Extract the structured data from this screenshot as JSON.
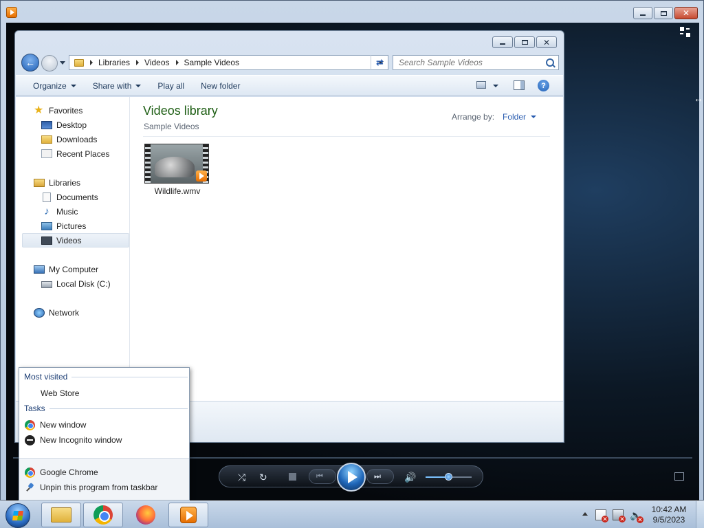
{
  "explorer": {
    "breadcrumb": [
      "Libraries",
      "Videos",
      "Sample Videos"
    ],
    "search_placeholder": "Search Sample Videos",
    "toolbar": {
      "organize": "Organize",
      "share_with": "Share with",
      "play_all": "Play all",
      "new_folder": "New folder"
    },
    "nav": {
      "favorites": "Favorites",
      "desktop": "Desktop",
      "downloads": "Downloads",
      "recent_places": "Recent Places",
      "libraries": "Libraries",
      "documents": "Documents",
      "music": "Music",
      "pictures": "Pictures",
      "videos": "Videos",
      "my_computer": "My Computer",
      "local_disk": "Local Disk (C:)",
      "network": "Network"
    },
    "content": {
      "title": "Videos library",
      "subtitle": "Sample Videos",
      "arrange_label": "Arrange by:",
      "arrange_value": "Folder",
      "files": [
        {
          "name": "Wildlife.wmv"
        }
      ]
    }
  },
  "jumplist": {
    "most_visited_header": "Most visited",
    "most_visited": [
      "Web Store"
    ],
    "tasks_header": "Tasks",
    "tasks": [
      "New window",
      "New Incognito window"
    ],
    "app_name": "Google Chrome",
    "unpin": "Unpin this program from taskbar"
  },
  "player": {
    "volume_fraction": 0.5
  },
  "taskbar": {
    "time": "10:42 AM",
    "date": "9/5/2023"
  }
}
